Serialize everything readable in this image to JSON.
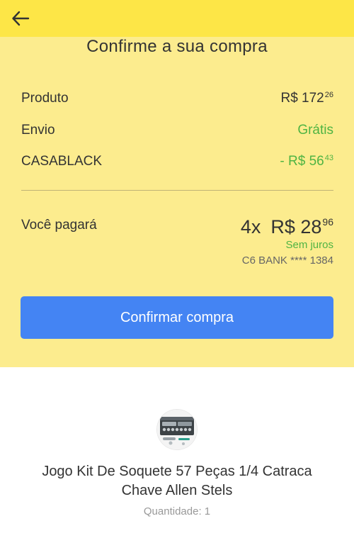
{
  "header": {
    "back_icon": "arrow-left-icon"
  },
  "page": {
    "title": "Confirme a sua compra"
  },
  "summary": {
    "product": {
      "label": "Produto",
      "currency": "R$",
      "amount": "172",
      "cents": "26"
    },
    "shipping": {
      "label": "Envio",
      "value": "Grátis"
    },
    "discount": {
      "label": "CASABLACK",
      "prefix": "- R$",
      "amount": "56",
      "cents": "43"
    }
  },
  "payment": {
    "label": "Você pagará",
    "installments": "4x",
    "currency": "R$",
    "amount": "28",
    "cents": "96",
    "interest_note": "Sem juros",
    "card": "C6 BANK **** 1384"
  },
  "confirm_button": {
    "label": "Confirmar compra"
  },
  "item": {
    "name": "Jogo Kit De Soquete 57 Peças 1/4 Catraca Chave Allen Stels",
    "quantity": "Quantidade: 1"
  },
  "colors": {
    "header_yellow": "#fde647",
    "panel_yellow": "#fcec8e",
    "accent_blue": "#4484f3",
    "success_green": "#4fb443"
  }
}
